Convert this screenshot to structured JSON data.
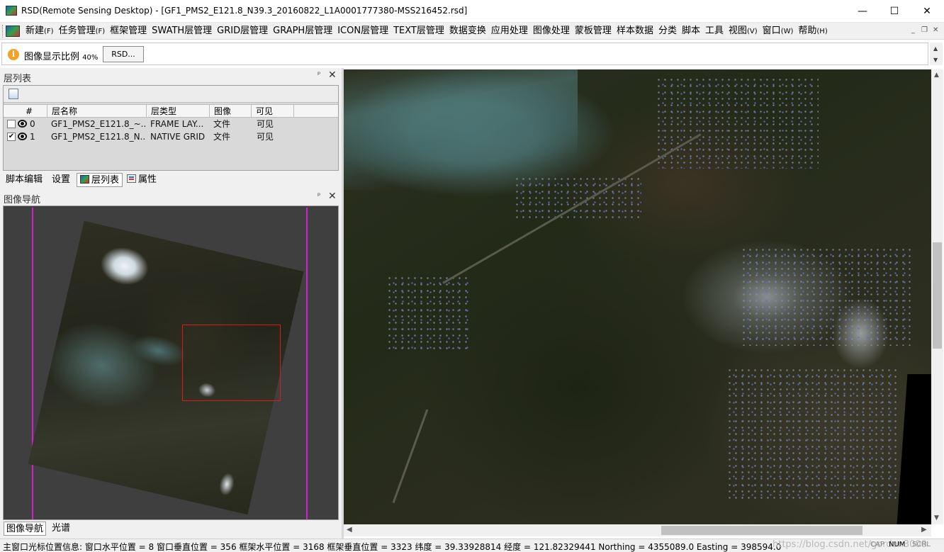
{
  "window": {
    "title": "RSD(Remote Sensing Desktop) - [GF1_PMS2_E121.8_N39.3_20160822_L1A0001777380-MSS216452.rsd]",
    "minimize": "—",
    "maximize": "☐",
    "close": "✕"
  },
  "menu": [
    {
      "label": "新建",
      "key": "(F)"
    },
    {
      "label": "任务管理",
      "key": "(F)"
    },
    {
      "label": "框架管理",
      "key": ""
    },
    {
      "label": "SWATH层管理",
      "key": ""
    },
    {
      "label": "GRID层管理",
      "key": ""
    },
    {
      "label": "GRAPH层管理",
      "key": ""
    },
    {
      "label": "ICON层管理",
      "key": ""
    },
    {
      "label": "TEXT层管理",
      "key": ""
    },
    {
      "label": "数据变换",
      "key": ""
    },
    {
      "label": "应用处理",
      "key": ""
    },
    {
      "label": "图像处理",
      "key": ""
    },
    {
      "label": "蒙板管理",
      "key": ""
    },
    {
      "label": "样本数据",
      "key": ""
    },
    {
      "label": "分类",
      "key": ""
    },
    {
      "label": "脚本",
      "key": ""
    },
    {
      "label": "工具",
      "key": ""
    },
    {
      "label": "视图",
      "key": "(V)"
    },
    {
      "label": "窗口",
      "key": "(W)"
    },
    {
      "label": "帮助",
      "key": "(H)"
    }
  ],
  "mdi_controls": {
    "minimize": "_",
    "restore": "❐",
    "close": "✕"
  },
  "infobar": {
    "icon": "info-icon",
    "label": "图像显示比例",
    "percent": "40%",
    "button_label": "RSD..."
  },
  "layer_panel": {
    "title": "层列表",
    "pin": "ᵖ",
    "close": "✕",
    "columns": [
      "#",
      "层名称",
      "层类型",
      "图像",
      "可见"
    ],
    "rows": [
      {
        "checked": false,
        "index": "0",
        "name": "GF1_PMS2_E121.8_~...",
        "type": "FRAME LAY...",
        "image": "文件",
        "visible": "可见"
      },
      {
        "checked": true,
        "index": "1",
        "name": "GF1_PMS2_E121.8_N...",
        "type": "NATIVE GRID",
        "image": "文件",
        "visible": "可见"
      }
    ]
  },
  "tabs": [
    {
      "label": "脚本编辑",
      "active": false
    },
    {
      "label": "设置",
      "active": false
    },
    {
      "label": "层列表",
      "active": true
    },
    {
      "label": "属性",
      "active": false
    }
  ],
  "nav_panel": {
    "title": "图像导航",
    "pin": "ᵖ",
    "close": "✕",
    "tabs": [
      {
        "label": "图像导航",
        "active": true
      },
      {
        "label": "光谱",
        "active": false
      }
    ]
  },
  "status": {
    "text": "主窗口光标位置信息:  窗口水平位置 = 8 窗口垂直位置 = 356 框架水平位置 = 3168 框架垂直位置 = 3323 纬度  = 39.33928814 经度  = 121.82329441 Northing = 4355089.0 Easting = 398594.0",
    "watermark": "https://blog.csdn.net/gordon3000",
    "indicators": [
      "CAP",
      "NUM",
      "SCRL"
    ]
  },
  "colors": {
    "nav_frame": "#d21fd2",
    "nav_viewport": "#e01818",
    "info_icon": "#f4a12a"
  }
}
